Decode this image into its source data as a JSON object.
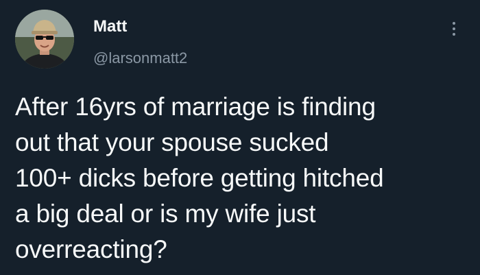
{
  "author": {
    "name": "Matt",
    "handle": "@larsonmatt2",
    "avatar_icon": "profile-photo"
  },
  "menu": {
    "icon": "more-options-icon"
  },
  "tweet": {
    "lines": [
      "After 16yrs of marriage is finding",
      "out that your spouse sucked",
      "100+ dicks before getting hitched",
      "a big deal or is my wife just",
      "overreacting?"
    ]
  },
  "colors": {
    "background": "#15202b",
    "text_primary": "#f7f9f9",
    "text_secondary": "#8b98a5"
  }
}
